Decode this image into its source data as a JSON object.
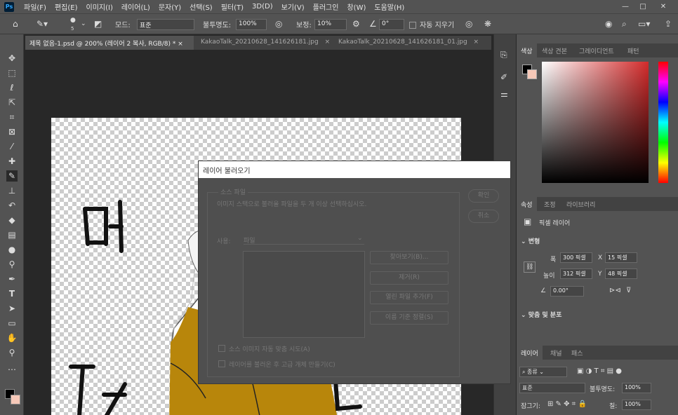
{
  "app": {
    "logo": "Ps"
  },
  "menu": [
    "파일(F)",
    "편집(E)",
    "이미지(I)",
    "레이어(L)",
    "문자(Y)",
    "선택(S)",
    "필터(T)",
    "3D(D)",
    "보기(V)",
    "플러그인",
    "창(W)",
    "도움말(H)"
  ],
  "options": {
    "brush_size": "5",
    "mode_label": "모드:",
    "mode_value": "표준",
    "opacity_label": "불투명도:",
    "opacity_value": "100%",
    "smoothing_label": "보정:",
    "smoothing_value": "10%",
    "angle_value": "0°",
    "auto_erase_label": "자동 지우기"
  },
  "tabs": [
    {
      "label": "제목 없음-1.psd @ 200% (레이어 2 복사, RGB/8) *",
      "active": true
    },
    {
      "label": "KakaoTalk_20210628_141626181.jpg",
      "active": false
    },
    {
      "label": "KakaoTalk_20210628_141626181_01.jpg",
      "active": false
    }
  ],
  "color_panel": {
    "tabs": [
      "색상",
      "색상 견본",
      "그레이디언트",
      "패턴"
    ],
    "colors": {
      "foreground": "#000000",
      "background": "#f6c8b8",
      "hue_sample": "#d32b2b"
    }
  },
  "properties_panel": {
    "tabs": [
      "속성",
      "조정",
      "라이브러리"
    ],
    "layer_type": "픽셀 레이어",
    "transform_label": "변형",
    "w_label": "폭",
    "w_value": "300 픽셀",
    "x_label": "X",
    "x_value": "15 픽셀",
    "h_label": "높이",
    "h_value": "312 픽셀",
    "y_label": "Y",
    "y_value": "48 픽셀",
    "angle_value": "0.00°",
    "align_label": "맞춤 및 분포"
  },
  "layers_panel": {
    "tabs": [
      "레이어",
      "채널",
      "패스"
    ],
    "filter_label": "종류",
    "blend_mode": "표준",
    "opacity_label": "불투명도:",
    "opacity_value": "100%",
    "lock_label": "잠그기:",
    "fill_label": "칠:",
    "fill_value": "100%"
  },
  "dialog": {
    "title": "레이어 불러오기",
    "group_label": "소스 파일",
    "instruction": "이미지 스택으로 불러올 파일을 두 개 이상 선택하십시오.",
    "use_label": "사용:",
    "use_value": "파일",
    "buttons": {
      "ok": "확인",
      "cancel": "취소",
      "browse": "찾아보기(B)...",
      "remove": "제거(R)",
      "add_open": "열린 파일 추가(F)",
      "sort_name": "이름 기준 정렬(S)"
    },
    "checkbox_align": "소스 이미지 자동 맞춤 시도(A)",
    "checkbox_smart": "레이어를 불러온 후 고급 개체 만들기(C)"
  }
}
